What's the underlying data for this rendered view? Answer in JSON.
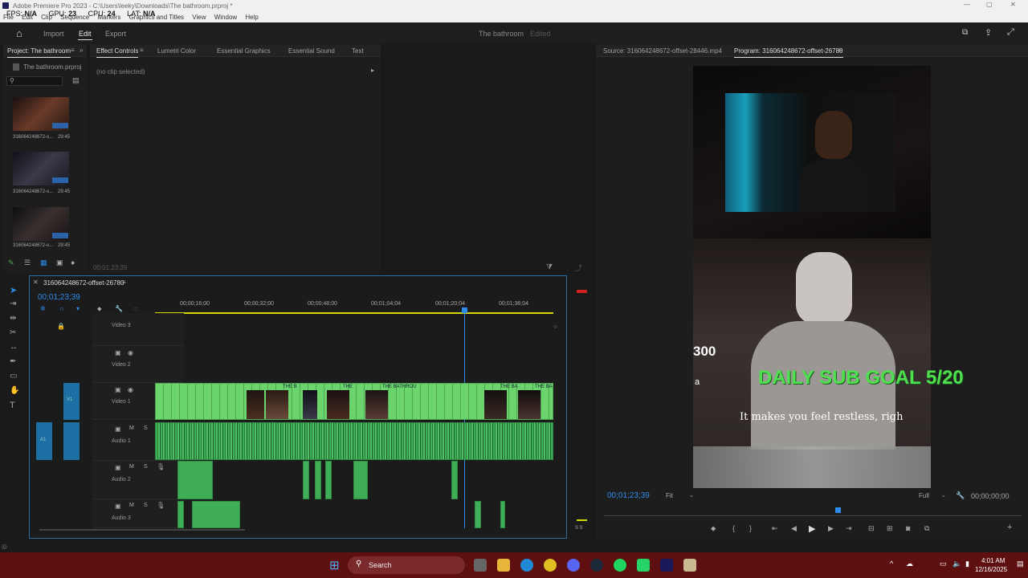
{
  "window": {
    "title": "Adobe Premiere Pro 2023 - C:\\Users\\leeky\\Downloads\\The bathroom.prproj *",
    "menu": [
      "File",
      "Edit",
      "Clip",
      "Sequence",
      "Markers",
      "Graphics and Titles",
      "View",
      "Window",
      "Help"
    ]
  },
  "overlay": {
    "fps_label": "FPS:",
    "fps": "N/A",
    "gpu_label": "GPU:",
    "gpu": "23",
    "cpu_label": "CPU:",
    "cpu": "24",
    "lat_label": "LAT:",
    "lat": "N/A"
  },
  "header": {
    "tabs": [
      "Import",
      "Edit",
      "Export"
    ],
    "active": "Edit",
    "project_name": "The bathroom",
    "status": "Edited"
  },
  "project_panel": {
    "tab": "Project: The bathroom",
    "file": "The bathroom.prproj",
    "items": [
      {
        "name": "316064248672-o...",
        "duration": "29:45"
      },
      {
        "name": "316064248672-o...",
        "duration": "29:45"
      },
      {
        "name": "316064248672-o...",
        "duration": "29:45"
      }
    ]
  },
  "effects_panel": {
    "tabs": [
      "Effect Controls",
      "Lumetri Color",
      "Essential Graphics",
      "Essential Sound",
      "Text"
    ],
    "no_clip": "(no clip selected)",
    "timecode": "00;01;23;39"
  },
  "monitors": {
    "source_tab": "Source: 316064248672-offset-28446.mp4",
    "program_tab": "Program: 316064248672-offset-26780",
    "timecode": "00;01;23;39",
    "fit": "Fit",
    "quality": "Full",
    "end_timecode": "00;00;00;00"
  },
  "video_overlay": {
    "sub_goal": "DAILY SUB GOAL 5/20",
    "subtitle": "It makes you feel restless, righ",
    "left_num": "300",
    "left_a": "a"
  },
  "timeline": {
    "sequence": "316064248672-offset-26780",
    "timecode": "00;01;23;39",
    "ruler": [
      "00;00;16;00",
      "00;00;32;00",
      "00;00;48;00",
      "00;01;04;04",
      "00;01;20;04",
      "00;01;36;04"
    ],
    "tracks": {
      "v3": "Video 3",
      "v2": "Video 2",
      "v1": "Video 1",
      "a1": "Audio 1",
      "a2": "Audio 2",
      "a3": "Audio 3"
    },
    "clip_labels": [
      "THE B",
      "THE",
      "THE BATHROU",
      "THE BA",
      "THE BA"
    ],
    "src_labels": {
      "v1": "V1",
      "a1": "A1"
    },
    "letters": {
      "m": "M",
      "s": "S"
    }
  },
  "taskbar": {
    "search": "Search",
    "time": "4:01 AM",
    "date": "12/16/2025"
  },
  "colors": {
    "accent_blue": "#2d8ceb",
    "clip_green": "#6cd46c",
    "audio_green": "#3fae56",
    "taskbar": "#5e1010"
  },
  "meter_label": "S S"
}
